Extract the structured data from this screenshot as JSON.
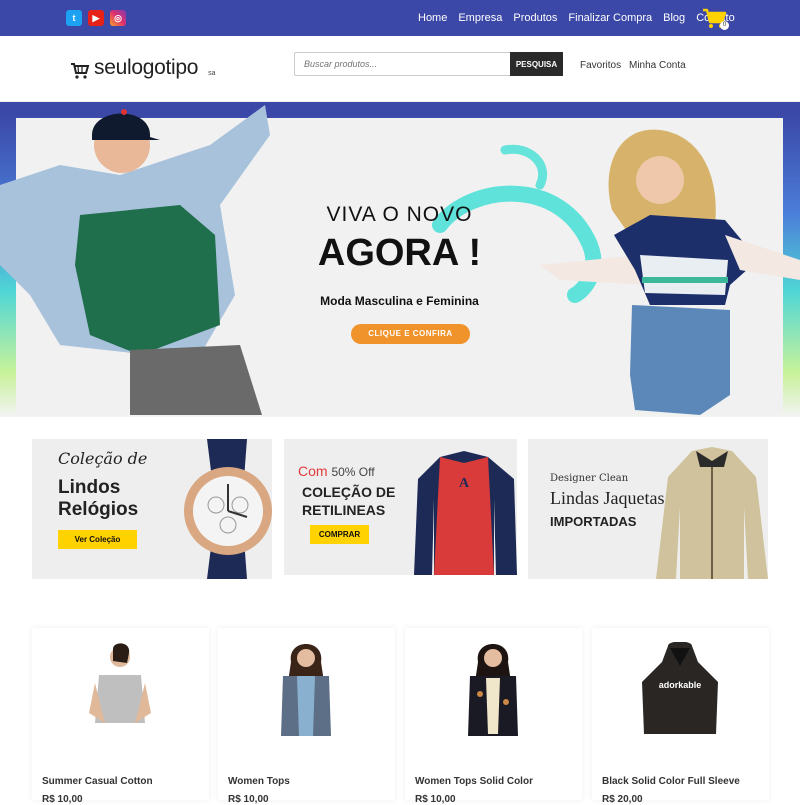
{
  "social": [
    {
      "name": "twitter",
      "icon": "twitter-icon",
      "glyph": "t",
      "color": "#1da1f2"
    },
    {
      "name": "youtube",
      "icon": "youtube-icon",
      "glyph": "▶",
      "color": "#e62117"
    },
    {
      "name": "instagram",
      "icon": "instagram-icon",
      "glyph": "◎",
      "color": "#e1306c"
    }
  ],
  "top_nav": [
    "Home",
    "Empresa",
    "Produtos",
    "Finalizar Compra",
    "Blog",
    "Contato"
  ],
  "cart": {
    "icon": "cart-icon",
    "count": "0",
    "color": "#ffd200"
  },
  "header": {
    "logo_text": "seulogotipo",
    "logo_sub": "sa",
    "search_placeholder": "Buscar produtos...",
    "search_button": "PESQUISA",
    "links": [
      "Favoritos",
      "Minha Conta"
    ]
  },
  "hero": {
    "title_line1": "VIVA O NOVO",
    "title_line2": "AGORA !",
    "subtitle": "Moda Masculina e Feminina",
    "button": "CLIQUE E CONFIRA",
    "accent": "#f0932b"
  },
  "promos": [
    {
      "line1": "Coleção de",
      "line2": "Lindos",
      "line3": "Relógios",
      "button": "Ver Coleção"
    },
    {
      "line1_a": "Com",
      "line1_b": "50% Off",
      "line2": "COLEÇÃO DE",
      "line3": "RETILINEAS",
      "button": "COMPRAR"
    },
    {
      "line1": "Designer Clean",
      "line2": "Lindas Jaquetas",
      "line3": "IMPORTADAS"
    }
  ],
  "products": [
    {
      "name": "Summer Casual Cotton",
      "price": "R$ 10,00"
    },
    {
      "name": "Women Tops",
      "price": "R$ 10,00"
    },
    {
      "name": "Women Tops Solid Color",
      "price": "R$ 10,00"
    },
    {
      "name": "Black Solid Color Full Sleeve",
      "price": "R$ 20,00",
      "print": "adorkable"
    }
  ]
}
